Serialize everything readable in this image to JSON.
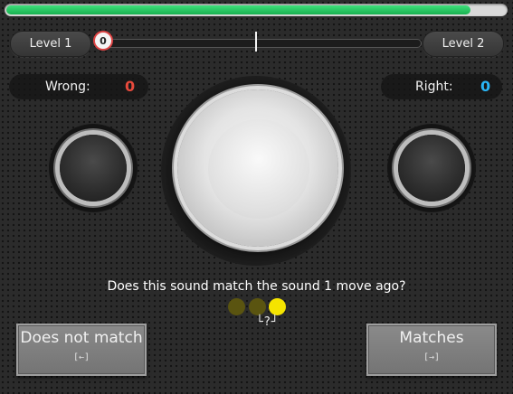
{
  "progress": {
    "fraction": 0.93
  },
  "levels": {
    "left": "Level 1",
    "right": "Level 2"
  },
  "slider": {
    "value": "0"
  },
  "scores": {
    "wrong_label": "Wrong:",
    "wrong_value": "0",
    "wrong_color": "#e84a3c",
    "right_label": "Right:",
    "right_value": "0",
    "right_color": "#29b6f6"
  },
  "question": "Does this sound match the sound 1 move ago?",
  "history_dots": [
    "#5a5410",
    "#5a5410",
    "#f5e400"
  ],
  "hint": "└?┘",
  "buttons": {
    "no_match_label": "Does not match",
    "no_match_key": "[←]",
    "match_label": "Matches",
    "match_key": "[→]"
  }
}
